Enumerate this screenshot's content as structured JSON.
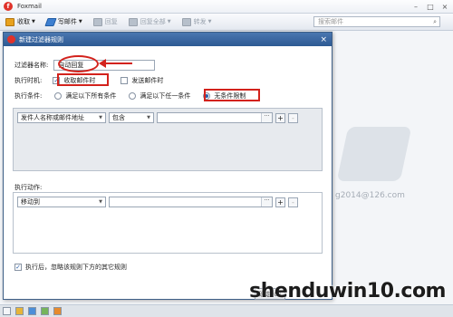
{
  "app": {
    "title": "Foxmail",
    "logo_letter": "f",
    "window_controls": [
      "–",
      "□",
      "×"
    ]
  },
  "toolbar": {
    "items": [
      {
        "label": "收取",
        "icon": "inbox-icon",
        "enabled": true
      },
      {
        "label": "写邮件",
        "icon": "compose-icon",
        "enabled": true
      },
      {
        "label": "回复",
        "icon": "reply-icon",
        "enabled": false
      },
      {
        "label": "回复全部",
        "icon": "reply-all-icon",
        "enabled": false
      },
      {
        "label": "转发",
        "icon": "forward-icon",
        "enabled": false
      }
    ],
    "search_placeholder": "搜索邮件",
    "more": "≡"
  },
  "background": {
    "email_fragment": "g2014@126.com"
  },
  "dialog": {
    "title": "新建过滤器规则",
    "close": "×",
    "filter_name_label": "过滤器名称:",
    "filter_name_value": "自动回复",
    "execute_when_label": "执行时机:",
    "on_receive": "收取邮件时",
    "on_receive_checked": true,
    "on_send": "发送邮件时",
    "on_send_checked": false,
    "condition_label": "执行条件:",
    "conditions": [
      "满足以下所有条件",
      "满足以下任一条件",
      "无条件限制"
    ],
    "selected_condition": 2,
    "condition_field": "发件人名称或邮件地址",
    "condition_operator": "包含",
    "condition_value": "",
    "action_label": "执行动作:",
    "action_type": "移动到",
    "action_value": "",
    "ellipsis": "···",
    "add": "+",
    "remove": "-",
    "stop_rules_label": "执行后，忽略该规则下方的其它规则",
    "stop_rules_checked": true,
    "ok_button": "确定(O)",
    "check_mark": "✓"
  },
  "watermark": "shenduwin10.com",
  "colors": {
    "annotation_red": "#d3221c",
    "dialog_title_bg": "#2d5a93",
    "accent_blue": "#2a5fa8"
  }
}
